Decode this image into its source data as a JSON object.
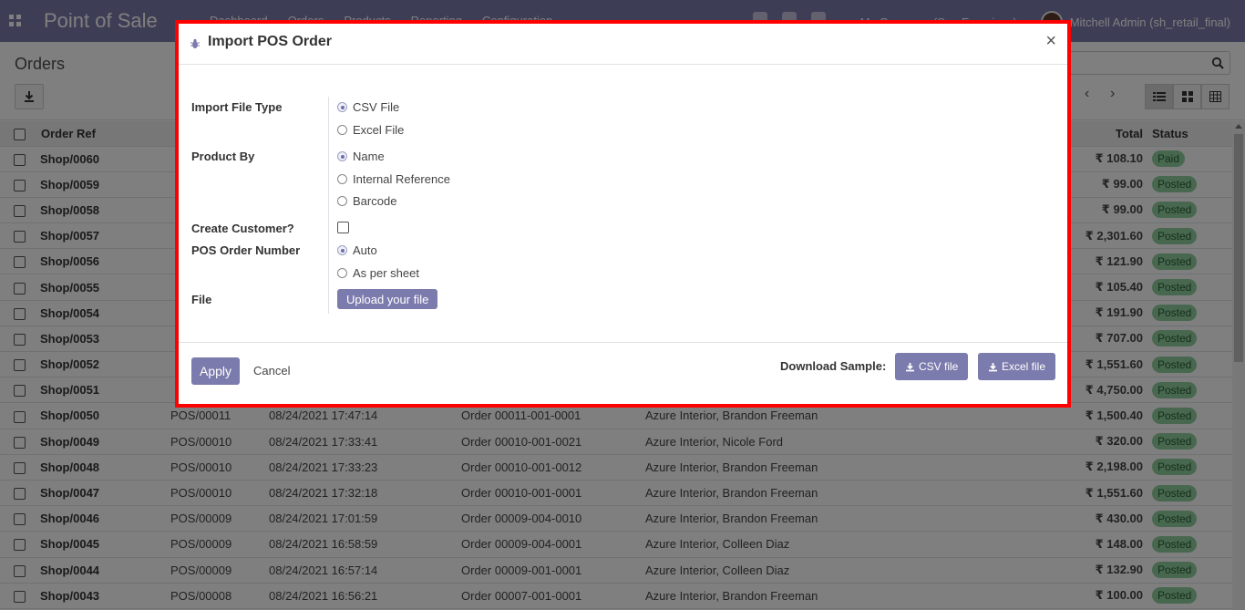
{
  "navbar": {
    "brand": "Point of Sale",
    "menu": [
      "Dashboard",
      "Orders",
      "Products",
      "Reporting",
      "Configuration"
    ],
    "company": "My Company (San Francisco)",
    "user": "Mitchell Admin (sh_retail_final)"
  },
  "control": {
    "breadcrumb": "Orders"
  },
  "table": {
    "headers": {
      "ref": "Order Ref",
      "total": "Total",
      "status": "Status"
    },
    "rows": [
      {
        "ref": "Shop/0060",
        "session": "",
        "date": "",
        "receipt": "",
        "customer": "",
        "total": "₹ 108.10",
        "status": "Paid"
      },
      {
        "ref": "Shop/0059",
        "session": "",
        "date": "",
        "receipt": "",
        "customer": "",
        "total": "₹ 99.00",
        "status": "Posted"
      },
      {
        "ref": "Shop/0058",
        "session": "",
        "date": "",
        "receipt": "",
        "customer": "",
        "total": "₹ 99.00",
        "status": "Posted"
      },
      {
        "ref": "Shop/0057",
        "session": "",
        "date": "",
        "receipt": "",
        "customer": "",
        "total": "₹ 2,301.60",
        "status": "Posted"
      },
      {
        "ref": "Shop/0056",
        "session": "",
        "date": "",
        "receipt": "",
        "customer": "",
        "total": "₹ 121.90",
        "status": "Posted"
      },
      {
        "ref": "Shop/0055",
        "session": "",
        "date": "",
        "receipt": "",
        "customer": "",
        "total": "₹ 105.40",
        "status": "Posted"
      },
      {
        "ref": "Shop/0054",
        "session": "",
        "date": "",
        "receipt": "",
        "customer": "",
        "total": "₹ 191.90",
        "status": "Posted"
      },
      {
        "ref": "Shop/0053",
        "session": "",
        "date": "",
        "receipt": "",
        "customer": "",
        "total": "₹ 707.00",
        "status": "Posted"
      },
      {
        "ref": "Shop/0052",
        "session": "",
        "date": "",
        "receipt": "",
        "customer": "",
        "total": "₹ 1,551.60",
        "status": "Posted"
      },
      {
        "ref": "Shop/0051",
        "session": "",
        "date": "",
        "receipt": "",
        "customer": "",
        "total": "₹ 4,750.00",
        "status": "Posted"
      },
      {
        "ref": "Shop/0050",
        "session": "POS/00011",
        "date": "08/24/2021 17:47:14",
        "receipt": "Order 00011-001-0001",
        "customer": "Azure Interior, Brandon Freeman",
        "total": "₹ 1,500.40",
        "status": "Posted"
      },
      {
        "ref": "Shop/0049",
        "session": "POS/00010",
        "date": "08/24/2021 17:33:41",
        "receipt": "Order 00010-001-0021",
        "customer": "Azure Interior, Nicole Ford",
        "total": "₹ 320.00",
        "status": "Posted"
      },
      {
        "ref": "Shop/0048",
        "session": "POS/00010",
        "date": "08/24/2021 17:33:23",
        "receipt": "Order 00010-001-0012",
        "customer": "Azure Interior, Brandon Freeman",
        "total": "₹ 2,198.00",
        "status": "Posted"
      },
      {
        "ref": "Shop/0047",
        "session": "POS/00010",
        "date": "08/24/2021 17:32:18",
        "receipt": "Order 00010-001-0001",
        "customer": "Azure Interior, Brandon Freeman",
        "total": "₹ 1,551.60",
        "status": "Posted"
      },
      {
        "ref": "Shop/0046",
        "session": "POS/00009",
        "date": "08/24/2021 17:01:59",
        "receipt": "Order 00009-004-0010",
        "customer": "Azure Interior, Brandon Freeman",
        "total": "₹ 430.00",
        "status": "Posted"
      },
      {
        "ref": "Shop/0045",
        "session": "POS/00009",
        "date": "08/24/2021 16:58:59",
        "receipt": "Order 00009-004-0001",
        "customer": "Azure Interior, Colleen Diaz",
        "total": "₹ 148.00",
        "status": "Posted"
      },
      {
        "ref": "Shop/0044",
        "session": "POS/00009",
        "date": "08/24/2021 16:57:14",
        "receipt": "Order 00009-001-0001",
        "customer": "Azure Interior, Colleen Diaz",
        "total": "₹ 132.90",
        "status": "Posted"
      },
      {
        "ref": "Shop/0043",
        "session": "POS/00008",
        "date": "08/24/2021 16:56:21",
        "receipt": "Order 00007-001-0001",
        "customer": "Azure Interior, Brandon Freeman",
        "total": "₹ 100.00",
        "status": "Posted"
      }
    ]
  },
  "modal": {
    "title": "Import POS Order",
    "close": "×",
    "labels": {
      "file_type": "Import File Type",
      "product_by": "Product By",
      "create_customer": "Create Customer?",
      "order_number": "POS Order Number",
      "file": "File"
    },
    "file_type_options": [
      "CSV File",
      "Excel File"
    ],
    "product_by_options": [
      "Name",
      "Internal Reference",
      "Barcode"
    ],
    "order_number_options": [
      "Auto",
      "As per sheet"
    ],
    "upload_label": "Upload your file",
    "apply_label": "Apply",
    "cancel_label": "Cancel",
    "download_label": "Download Sample:",
    "csv_sample_label": "CSV file",
    "excel_sample_label": "Excel file"
  },
  "colors": {
    "brand": "#7c7bad",
    "highlight_border": "#ff0000",
    "status_badge": "#8fd19e"
  }
}
